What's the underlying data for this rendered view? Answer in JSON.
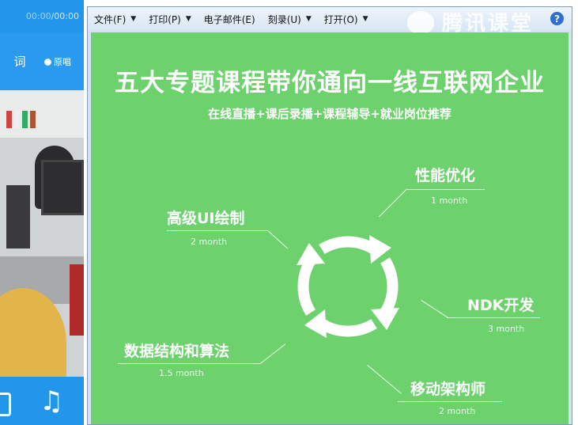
{
  "player": {
    "time_current": "00:00",
    "time_total": "/00:00",
    "lyric_label": "词",
    "original_label": "原唱"
  },
  "menu": {
    "items": [
      {
        "label": "文件(F)"
      },
      {
        "label": "打印(P)"
      },
      {
        "label": "电子邮件(E)"
      },
      {
        "label": "刻录(U)"
      },
      {
        "label": "打开(O)"
      }
    ],
    "help": "?"
  },
  "watermark": {
    "text": "腾讯课堂"
  },
  "slide": {
    "title": "五大专题课程带你通向一线互联网企业",
    "subtitle": "在线直播+课后录播+课程辅导+就业岗位推荐",
    "topics": [
      {
        "label": "性能优化",
        "duration": "1 month"
      },
      {
        "label": "高级UI绘制",
        "duration": "2 month"
      },
      {
        "label": "NDK开发",
        "duration": "3 month"
      },
      {
        "label": "数据结构和算法",
        "duration": "1.5 month"
      },
      {
        "label": "移动架构师",
        "duration": "2 month"
      }
    ]
  },
  "colors": {
    "slide_bg": "#6dd26e",
    "player_blue": "#2196ea",
    "help_blue": "#2f6fd1"
  }
}
